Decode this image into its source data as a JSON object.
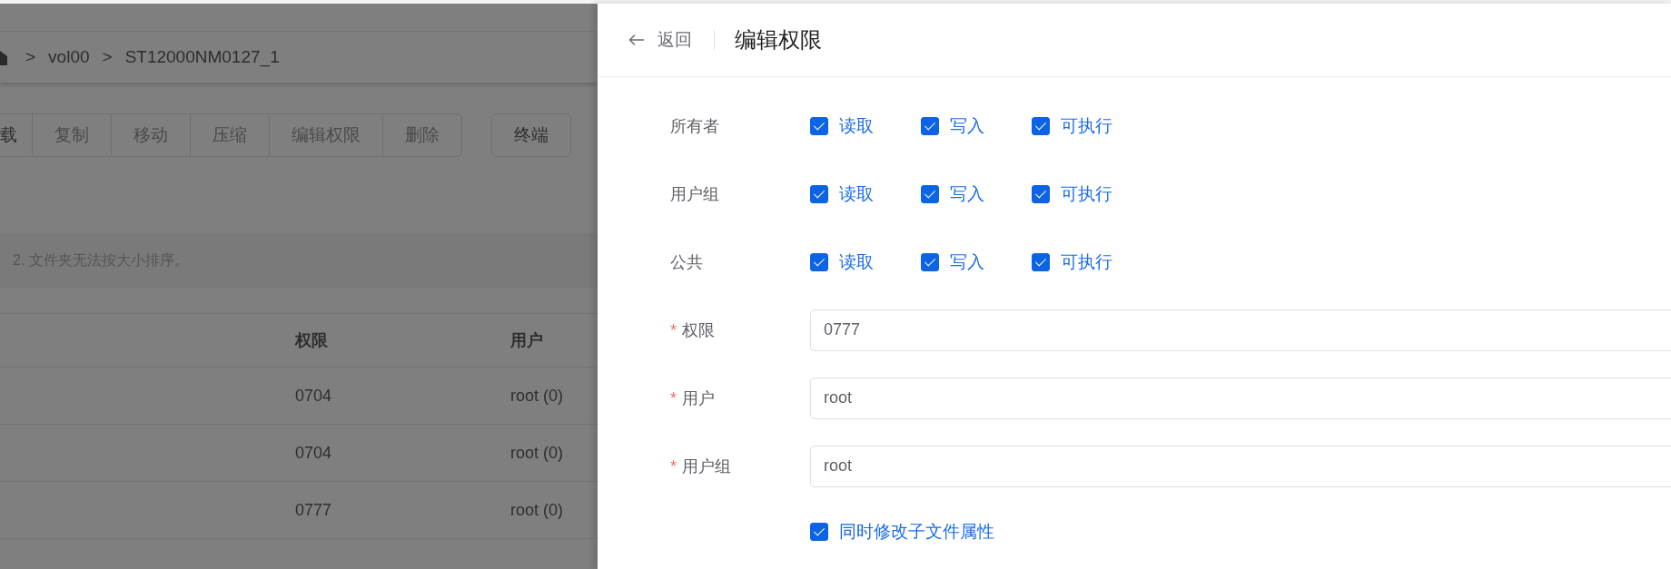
{
  "background": {
    "breadcrumb": {
      "separator": ">",
      "items": [
        "vol00",
        "ST12000NM0127_1"
      ]
    },
    "toolbar": [
      {
        "label": "载"
      },
      {
        "label": "复制"
      },
      {
        "label": "移动"
      },
      {
        "label": "压缩"
      },
      {
        "label": "编辑权限"
      },
      {
        "label": "删除"
      }
    ],
    "terminal_button": "终端",
    "notice": "2. 文件夹无法按大小排序。",
    "table": {
      "columns": [
        "权限",
        "用户"
      ],
      "rows": [
        [
          "0704",
          "root (0)"
        ],
        [
          "0704",
          "root (0)"
        ],
        [
          "0777",
          "root (0)"
        ]
      ]
    }
  },
  "drawer": {
    "back": "返回",
    "title": "编辑权限",
    "permissions": [
      {
        "label": "所有者",
        "options": [
          {
            "label": "读取",
            "checked": true
          },
          {
            "label": "写入",
            "checked": true
          },
          {
            "label": "可执行",
            "checked": true
          }
        ]
      },
      {
        "label": "用户组",
        "options": [
          {
            "label": "读取",
            "checked": true
          },
          {
            "label": "写入",
            "checked": true
          },
          {
            "label": "可执行",
            "checked": true
          }
        ]
      },
      {
        "label": "公共",
        "options": [
          {
            "label": "读取",
            "checked": true
          },
          {
            "label": "写入",
            "checked": true
          },
          {
            "label": "可执行",
            "checked": true
          }
        ]
      }
    ],
    "fields": [
      {
        "label": "权限",
        "required_mark": "*",
        "value": "0777"
      },
      {
        "label": "用户",
        "required_mark": "*",
        "value": "root"
      },
      {
        "label": "用户组",
        "required_mark": "*",
        "value": "root"
      }
    ],
    "recursive": {
      "label": "同时修改子文件属性",
      "checked": true
    }
  }
}
